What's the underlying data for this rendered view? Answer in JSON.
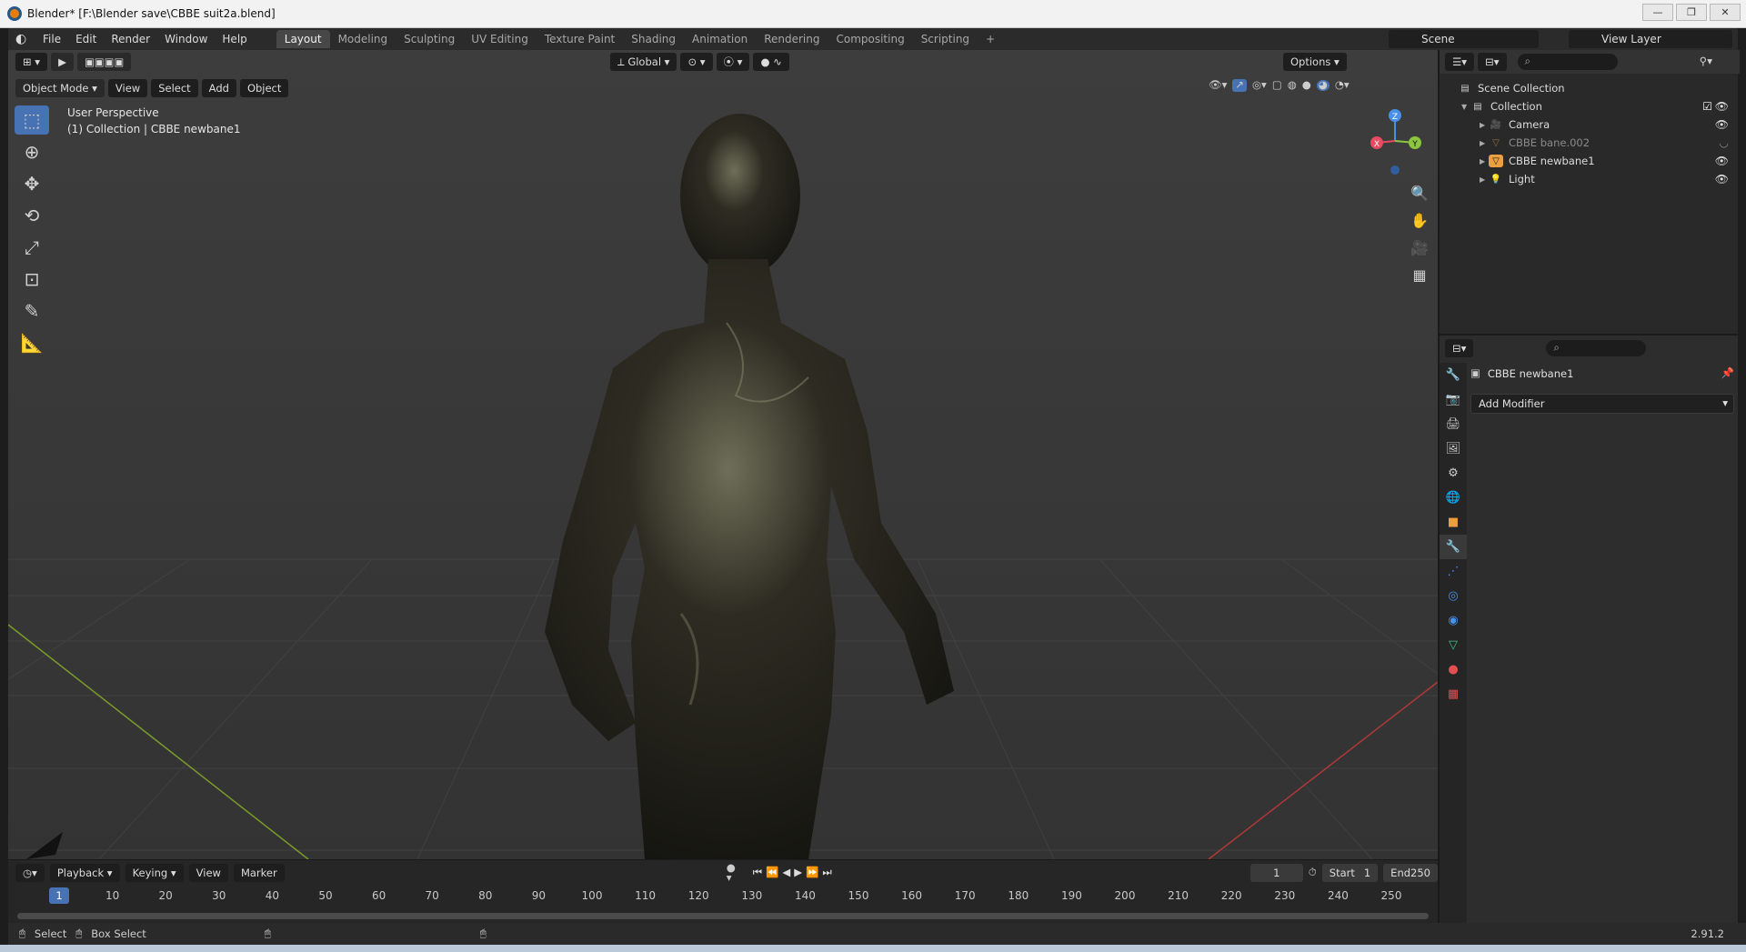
{
  "window": {
    "title": "Blender* [F:\\Blender save\\CBBE suit2a.blend]",
    "minimize": "—",
    "maximize": "❐",
    "close": "✕"
  },
  "menu": {
    "items": [
      "File",
      "Edit",
      "Render",
      "Window",
      "Help"
    ]
  },
  "workspaces": {
    "tabs": [
      "Layout",
      "Modeling",
      "Sculpting",
      "UV Editing",
      "Texture Paint",
      "Shading",
      "Animation",
      "Rendering",
      "Compositing",
      "Scripting"
    ],
    "active": "Layout",
    "add": "+"
  },
  "scene": {
    "name": "Scene",
    "view_layer": "View Layer"
  },
  "viewport": {
    "mode": "Object Mode",
    "menus": [
      "View",
      "Select",
      "Add",
      "Object"
    ],
    "orientation": "Global",
    "options": "Options",
    "perspective": "User Perspective",
    "collection_info": "(1) Collection | CBBE newbane1",
    "axis_labels": {
      "x": "X",
      "y": "Y",
      "z": "Z"
    }
  },
  "outliner": {
    "root": "Scene Collection",
    "collection": "Collection",
    "items": [
      {
        "label": "Camera",
        "icon": "camera-icon",
        "dim": false
      },
      {
        "label": "CBBE bane.002",
        "icon": "mesh-icon",
        "dim": true
      },
      {
        "label": "CBBE newbane1",
        "icon": "mesh-icon",
        "dim": false
      },
      {
        "label": "Light",
        "icon": "light-icon",
        "dim": false
      }
    ]
  },
  "properties": {
    "object_name": "CBBE newbane1",
    "add_modifier": "Add Modifier"
  },
  "timeline": {
    "menus": [
      "Playback",
      "Keying",
      "View",
      "Marker"
    ],
    "current_frame": "1",
    "start_label": "Start",
    "start": "1",
    "end_label": "End",
    "end": "250",
    "ruler": [
      "1",
      "10",
      "20",
      "30",
      "40",
      "50",
      "60",
      "70",
      "80",
      "90",
      "100",
      "110",
      "120",
      "130",
      "140",
      "150",
      "160",
      "170",
      "180",
      "190",
      "200",
      "210",
      "220",
      "230",
      "240",
      "250"
    ]
  },
  "status": {
    "select": "Select",
    "box_select": "Box Select",
    "version": "2.91.2"
  },
  "colors": {
    "accent": "#4772b3",
    "x_axis": "#e84a5f",
    "y_axis": "#8cc63f",
    "z_axis": "#4a8fe8",
    "mesh": "#e8a040"
  }
}
